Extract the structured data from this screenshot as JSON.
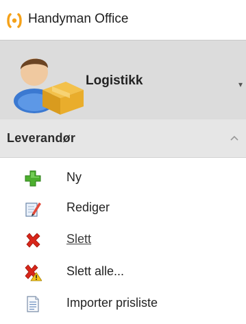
{
  "app": {
    "title": "Handyman Office"
  },
  "module": {
    "title": "Logistikk"
  },
  "section": {
    "title": "Leverandør"
  },
  "actions": [
    {
      "label": "Ny",
      "icon": "plus-icon"
    },
    {
      "label": "Rediger",
      "icon": "edit-icon"
    },
    {
      "label": "Slett",
      "icon": "delete-icon"
    },
    {
      "label": "Slett alle...",
      "icon": "delete-all-warning-icon"
    },
    {
      "label": "Importer prisliste",
      "icon": "document-icon"
    }
  ],
  "colors": {
    "logo_orange": "#f5a21a",
    "header_bg": "#dcdcdc",
    "section_bg": "#e6e6e6",
    "green": "#4caf2e",
    "red": "#d8261a"
  }
}
